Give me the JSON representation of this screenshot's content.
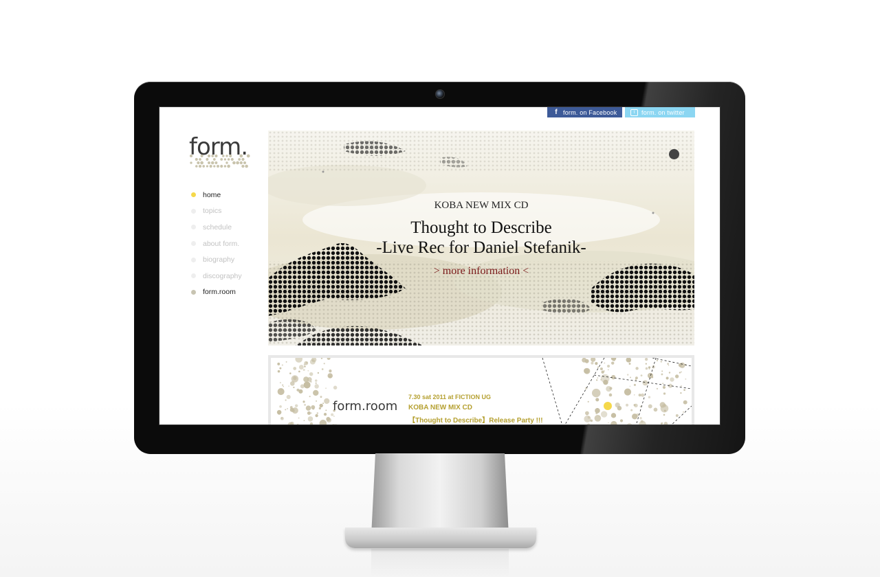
{
  "social": {
    "facebook_label": "form. on Facebook",
    "twitter_label": "form. on twitter",
    "facebook_color": "#3d5a98",
    "twitter_color": "#8bd6f2"
  },
  "logo": {
    "text": "form."
  },
  "nav": {
    "items": [
      {
        "label": "home",
        "state": "active"
      },
      {
        "label": "topics",
        "state": "inactive"
      },
      {
        "label": "schedule",
        "state": "inactive"
      },
      {
        "label": "about form.",
        "state": "inactive"
      },
      {
        "label": "biography",
        "state": "inactive"
      },
      {
        "label": "discography",
        "state": "inactive"
      },
      {
        "label": "form.room",
        "state": "highlight"
      }
    ],
    "active_color": "#f5d84a"
  },
  "hero": {
    "kicker": "KOBA NEW MIX CD",
    "title_line1": "Thought to Describe",
    "title_line2": "-Live Rec for Daniel Stefanik-",
    "more_link": "> more information <"
  },
  "banner": {
    "logo": "form.room",
    "line1": "7.30 sat 2011 at FICTION UG",
    "line2": "KOBA NEW MIX CD",
    "line3": "【Thought to Describe】Release Party !!!",
    "accent_color": "#b5a030"
  }
}
